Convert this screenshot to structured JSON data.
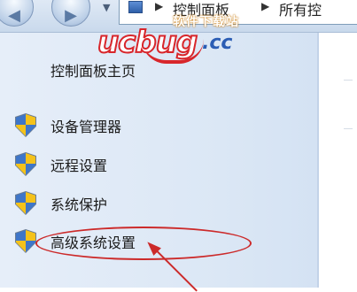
{
  "breadcrumb": {
    "items": [
      "控制面板",
      "所有控"
    ],
    "separator": "▶"
  },
  "nav": {
    "back_icon": "back-arrow-icon",
    "forward_icon": "forward-arrow-icon"
  },
  "watermark": {
    "subtitle": "软件下载站",
    "brand": "ucbug",
    "suffix": ".cc"
  },
  "sidebar": {
    "home_link": "控制面板主页",
    "tasks": [
      {
        "label": "设备管理器",
        "icon": "uac-shield-icon"
      },
      {
        "label": "远程设置",
        "icon": "uac-shield-icon"
      },
      {
        "label": "系统保护",
        "icon": "uac-shield-icon"
      },
      {
        "label": "高级系统设置",
        "icon": "uac-shield-icon"
      }
    ]
  },
  "colors": {
    "annotation": "#cc2a2a",
    "sidebar_bg": "#dbe7f5"
  }
}
